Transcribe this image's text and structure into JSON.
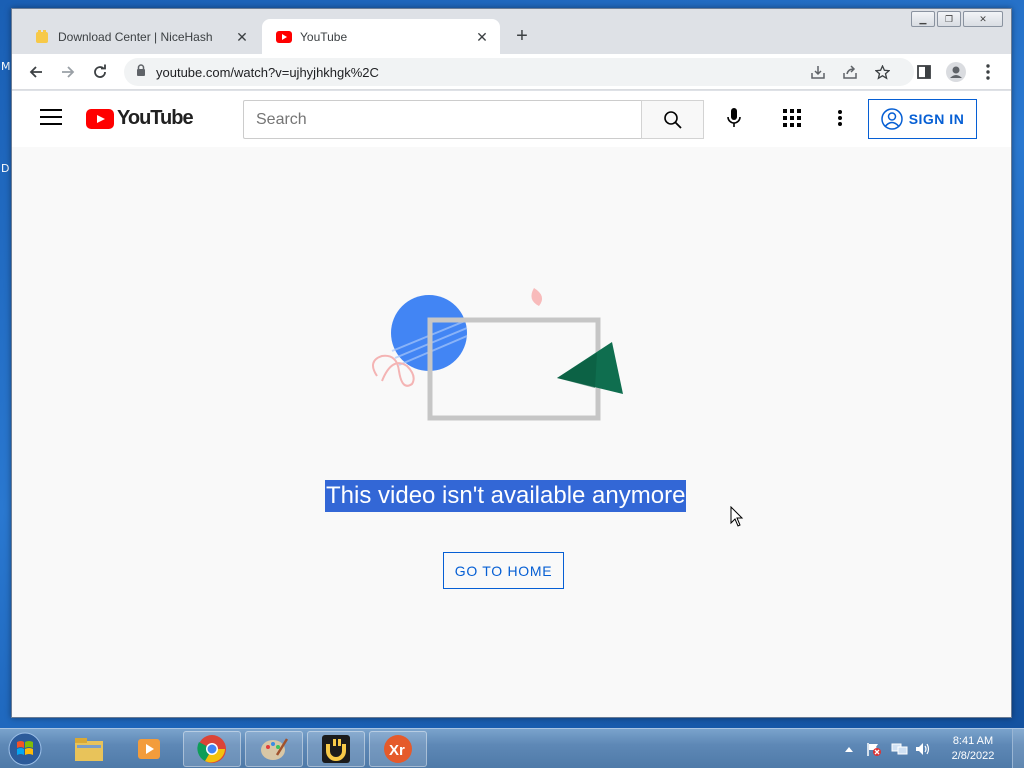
{
  "desktop": {
    "edge_chars": [
      "M",
      "D"
    ]
  },
  "browser": {
    "tabs": [
      {
        "title": "Download Center | NiceHash",
        "active": false
      },
      {
        "title": "YouTube",
        "active": true
      }
    ],
    "new_tab_label": "+",
    "url": "youtube.com/watch?v=ujhyjhkhgk%2C",
    "window_controls": [
      "minimize",
      "maximize",
      "close"
    ]
  },
  "youtube": {
    "logo_text": "YouTube",
    "search_placeholder": "Search",
    "sign_in_label": "SIGN IN",
    "error_message": "This video isn't available anymore",
    "go_home_label": "GO TO HOME"
  },
  "taskbar": {
    "time": "8:41 AM",
    "date": "2/8/2022",
    "apps": [
      "windows-explorer",
      "media-player",
      "chrome",
      "paint",
      "nicehash",
      "xr-app"
    ]
  },
  "colors": {
    "accent_blue": "#065fd4",
    "youtube_red": "#ff0000",
    "selection": "#3367d6"
  }
}
